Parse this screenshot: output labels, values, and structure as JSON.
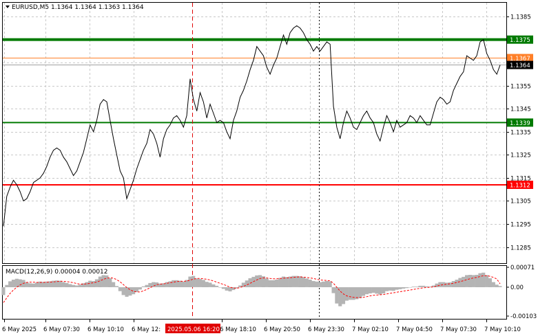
{
  "header": {
    "symbol_text": "EURUSD,M5",
    "ohlc_text": "1.1364 1.1364 1.1363 1.1364"
  },
  "macd": {
    "label": "MACD(12,26,9) 0.00004 0.00012",
    "tick_labels": [
      "0.00071",
      "0.00",
      "-0.00103"
    ]
  },
  "colors": {
    "background": "#ffffff",
    "price_line": "#000000",
    "support_green": "#007a00",
    "resistance_red": "#ff0000",
    "bid_line": "#ff7f27",
    "histogram": "#b4b4b4",
    "signal": "#ff0000",
    "grid": "#c8c8c8"
  },
  "chart_data": [
    {
      "type": "line",
      "title": "EURUSD,M5",
      "ylim": [
        1.1278,
        1.1391
      ],
      "y_ticks": [
        "1.1385",
        "1.1375",
        "1.1365",
        "1.1355",
        "1.1345",
        "1.1335",
        "1.1325",
        "1.1315",
        "1.1305",
        "1.1295",
        "1.1285"
      ],
      "x_tick_labels": [
        "6 May 2025",
        "6 May 07:30",
        "6 May 10:10",
        "6 May 12:",
        "6 May 18:10",
        "6 May 20:50",
        "6 May 23:30",
        "7 May 02:10",
        "7 May 04:50",
        "7 May 07:30",
        "7 May 10:10"
      ],
      "cursor_label": "2025.05.06 16:20",
      "horizontal_levels": [
        {
          "label": "1.1375",
          "value": 1.1375,
          "color": "#007a00"
        },
        {
          "label": "1.1339",
          "value": 1.1339,
          "color": "#007a00"
        },
        {
          "label": "1.1312",
          "value": 1.1312,
          "color": "#ff0000"
        }
      ],
      "ask_label": "1.1367",
      "ask_value": 1.1367,
      "bid_label": "1.1364",
      "bid_value": 1.1364,
      "series": [
        {
          "values": [
            1.1294,
            1.1307,
            1.1311,
            1.1314,
            1.1312,
            1.1309,
            1.1305,
            1.1306,
            1.1309,
            1.1313,
            1.1314,
            1.1315,
            1.1317,
            1.132,
            1.1324,
            1.1327,
            1.1328,
            1.1327,
            1.1324,
            1.1322,
            1.1319,
            1.1316,
            1.1318,
            1.1322,
            1.1326,
            1.1332,
            1.1338,
            1.1335,
            1.134,
            1.1347,
            1.1349,
            1.1348,
            1.134,
            1.1332,
            1.1325,
            1.1318,
            1.1315,
            1.1306,
            1.131,
            1.1314,
            1.1319,
            1.1323,
            1.1327,
            1.133,
            1.1336,
            1.1334,
            1.133,
            1.1324,
            1.1332,
            1.1336,
            1.1338,
            1.1341,
            1.1342,
            1.134,
            1.1337,
            1.1342,
            1.1358,
            1.1349,
            1.1344,
            1.1352,
            1.1348,
            1.1341,
            1.1347,
            1.1343,
            1.1339,
            1.134,
            1.1339,
            1.1335,
            1.1332,
            1.134,
            1.1344,
            1.135,
            1.1353,
            1.1357,
            1.1362,
            1.1366,
            1.1372,
            1.137,
            1.1368,
            1.1363,
            1.136,
            1.1364,
            1.1367,
            1.1372,
            1.1377,
            1.1373,
            1.1378,
            1.138,
            1.1381,
            1.138,
            1.1378,
            1.1375,
            1.1373,
            1.137,
            1.1372,
            1.137,
            1.1372,
            1.1374,
            1.1373,
            1.1346,
            1.1337,
            1.1332,
            1.1339,
            1.1344,
            1.1341,
            1.1337,
            1.1336,
            1.1339,
            1.1342,
            1.1344,
            1.1341,
            1.1339,
            1.1334,
            1.1331,
            1.1337,
            1.1342,
            1.1339,
            1.1335,
            1.134,
            1.1337,
            1.1338,
            1.1339,
            1.1342,
            1.1341,
            1.1339,
            1.1342,
            1.134,
            1.1338,
            1.1338,
            1.1343,
            1.1348,
            1.135,
            1.1349,
            1.1347,
            1.1348,
            1.1353,
            1.1356,
            1.1359,
            1.1361,
            1.1368,
            1.1367,
            1.1366,
            1.1368,
            1.1374,
            1.1375,
            1.1369,
            1.1366,
            1.1362,
            1.136,
            1.1364
          ]
        }
      ]
    },
    {
      "type": "bar",
      "title": "MACD(12,26,9) 0.00004 0.00012",
      "ylim": [
        -0.00103,
        0.00071
      ],
      "series": [
        {
          "values": [
            -0.00028,
            8e-05,
            0.00021,
            0.00027,
            0.0003,
            0.00028,
            0.00026,
            0.00018,
            0.00014,
            0.00013,
            0.00016,
            0.0002,
            0.00019,
            0.0002,
            0.00021,
            0.00023,
            0.00024,
            0.00023,
            0.00018,
            0.00015,
            0.00011,
            8e-05,
            6e-05,
            9e-05,
            0.00014,
            0.00018,
            0.00023,
            0.00022,
            0.00028,
            0.00038,
            0.00043,
            0.00042,
            0.00032,
            0.00018,
            4e-05,
            -0.00014,
            -0.00028,
            -0.00034,
            -0.0003,
            -0.00025,
            -0.00017,
            -8e-05,
            3e-05,
            8e-05,
            0.00015,
            0.00018,
            0.00017,
            0.00013,
            0.00014,
            0.00018,
            0.00021,
            0.00025,
            0.00025,
            0.00023,
            0.0002,
            0.00026,
            0.00038,
            0.0004,
            0.00031,
            0.00029,
            0.00026,
            0.00019,
            0.00016,
            0.0001,
            5e-05,
            0.0,
            -6e-05,
            -0.00012,
            -0.00015,
            -0.0001,
            -4e-05,
            6e-05,
            0.00016,
            0.00024,
            0.00032,
            0.00037,
            0.00042,
            0.00043,
            0.00039,
            0.00031,
            0.00025,
            0.00025,
            0.00027,
            0.00033,
            0.00038,
            0.00036,
            0.00038,
            0.0004,
            0.0004,
            0.00039,
            0.00036,
            0.00031,
            0.00027,
            0.00022,
            0.0002,
            0.00018,
            0.0002,
            0.00022,
            0.00021,
            -0.00021,
            -0.00058,
            -0.00068,
            -0.0006,
            -0.00048,
            -0.00045,
            -0.00045,
            -0.00043,
            -0.00039,
            -0.00031,
            -0.00025,
            -0.00022,
            -0.0002,
            -0.00023,
            -0.00026,
            -0.00022,
            -0.00014,
            -0.00012,
            -0.00013,
            -9e-05,
            -7e-05,
            -5e-05,
            -3e-05,
            0.0,
            2e-05,
            2e-05,
            5e-05,
            5e-05,
            3e-05,
            2e-05,
            6e-05,
            0.00013,
            0.00018,
            0.00018,
            0.00016,
            0.00017,
            0.00022,
            0.00027,
            0.00033,
            0.00037,
            0.00043,
            0.00044,
            0.00043,
            0.00044,
            0.0005,
            0.00052,
            0.00043,
            0.00032,
            0.00018,
            9e-05,
            4e-05
          ]
        },
        {
          "values": [
            -0.00055,
            -0.00038,
            -0.00022,
            -0.0001,
            0.0,
            8e-05,
            0.00014,
            0.00017,
            0.00018,
            0.00018,
            0.00017,
            0.00017,
            0.00017,
            0.00018,
            0.00018,
            0.00019,
            0.0002,
            0.00021,
            0.00021,
            0.0002,
            0.00018,
            0.00016,
            0.00013,
            0.00011,
            0.00011,
            0.00012,
            0.00014,
            0.00016,
            0.00018,
            0.00023,
            0.00028,
            0.00032,
            0.00034,
            0.00032,
            0.00027,
            0.00019,
            9e-05,
            -1e-05,
            -9e-05,
            -0.00015,
            -0.00017,
            -0.00017,
            -0.00013,
            -8e-05,
            -2e-05,
            4e-05,
            9e-05,
            0.00011,
            0.00012,
            0.00014,
            0.00016,
            0.00018,
            0.0002,
            0.00021,
            0.00021,
            0.00022,
            0.00025,
            0.00029,
            0.00031,
            0.00031,
            0.0003,
            0.00028,
            0.00026,
            0.00022,
            0.00018,
            0.00014,
            0.0001,
            5e-05,
            0.0,
            -3e-05,
            -4e-05,
            -1e-05,
            3e-05,
            8e-05,
            0.00014,
            0.0002,
            0.00026,
            0.00031,
            0.00033,
            0.00033,
            0.00031,
            0.0003,
            0.0003,
            0.00031,
            0.00032,
            0.00033,
            0.00034,
            0.00035,
            0.00036,
            0.00037,
            0.00036,
            0.00035,
            0.00033,
            0.00031,
            0.00028,
            0.00026,
            0.00025,
            0.00024,
            0.00023,
            0.00014,
            0.0,
            -0.00014,
            -0.00024,
            -0.00031,
            -0.00034,
            -0.00036,
            -0.00037,
            -0.00037,
            -0.00036,
            -0.00034,
            -0.00031,
            -0.00029,
            -0.00028,
            -0.00027,
            -0.00026,
            -0.00024,
            -0.00022,
            -0.0002,
            -0.00018,
            -0.00016,
            -0.00014,
            -0.00012,
            -0.0001,
            -8e-05,
            -6e-05,
            -4e-05,
            -2e-05,
            -1e-05,
            0.0,
            1e-05,
            4e-05,
            7e-05,
            9e-05,
            0.00011,
            0.00012,
            0.00014,
            0.00017,
            0.0002,
            0.00023,
            0.00027,
            0.0003,
            0.00033,
            0.00035,
            0.00038,
            0.00041,
            0.00041,
            0.00039,
            0.00035,
            0.00029,
            0.00012
          ]
        }
      ]
    }
  ]
}
